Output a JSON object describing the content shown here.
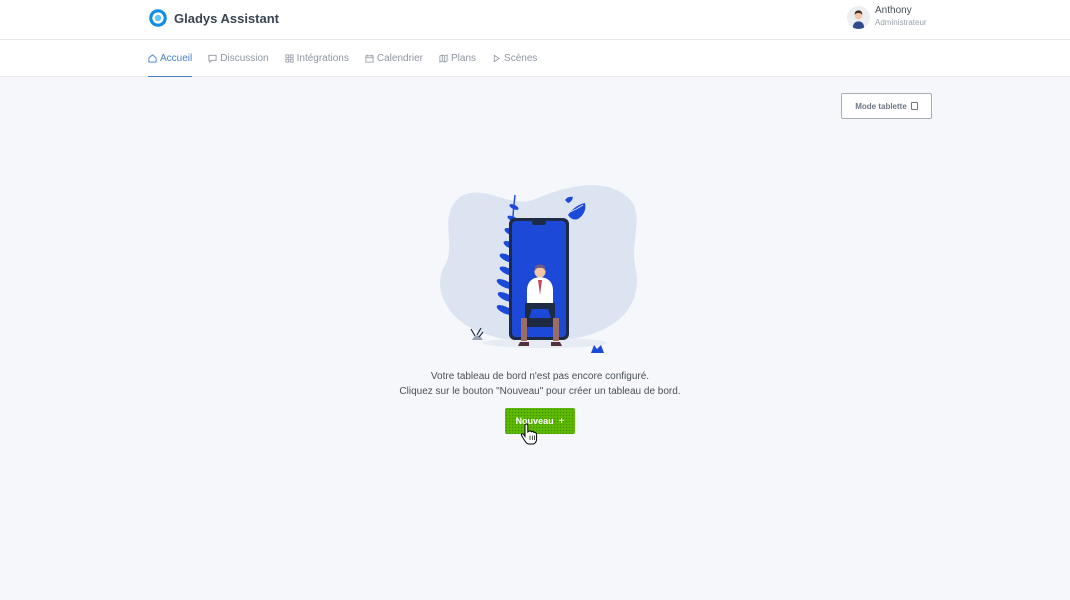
{
  "app": {
    "title": "Gladys Assistant"
  },
  "user": {
    "name": "Anthony",
    "role": "Administrateur"
  },
  "nav": {
    "items": [
      {
        "label": "Accueil",
        "icon": "home-icon",
        "active": true
      },
      {
        "label": "Discussion",
        "icon": "chat-icon",
        "active": false
      },
      {
        "label": "Intégrations",
        "icon": "grid-icon",
        "active": false
      },
      {
        "label": "Calendrier",
        "icon": "calendar-icon",
        "active": false
      },
      {
        "label": "Plans",
        "icon": "map-icon",
        "active": false
      },
      {
        "label": "Scènes",
        "icon": "play-icon",
        "active": false
      }
    ]
  },
  "dashboard": {
    "tablet_mode_label": "Mode tablette",
    "empty_line1": "Votre tableau de bord n'est pas encore configuré.",
    "empty_line2": "Cliquez sur le bouton \"Nouveau\" pour créer un tableau de bord.",
    "new_button_label": "Nouveau",
    "new_button_icon": "+"
  },
  "colors": {
    "accent": "#467fcf",
    "success": "#5eba00",
    "brand": "#0d8de4",
    "background": "#f5f7fb"
  }
}
